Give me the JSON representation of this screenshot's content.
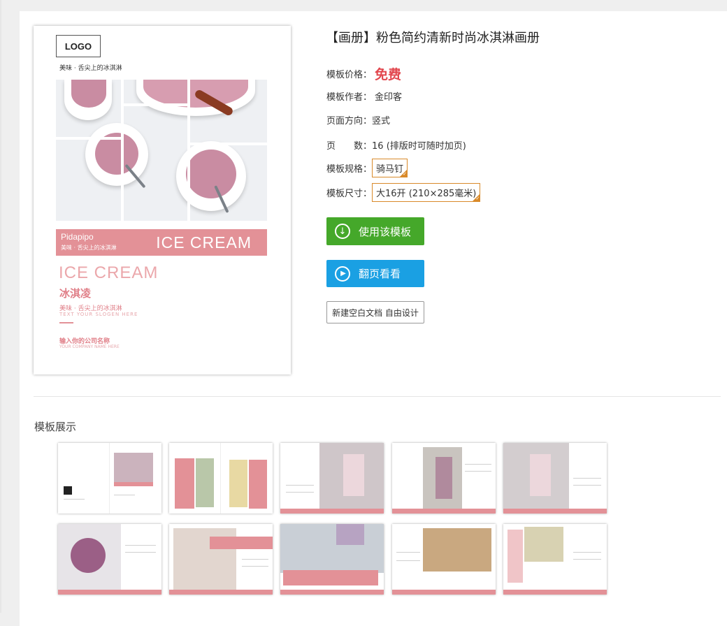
{
  "product": {
    "title": "【画册】粉色简约清新时尚冰淇淋画册",
    "price_label": "模板价格：",
    "price_value": "免费",
    "author_label": "模板作者：",
    "author_value": "金印客",
    "orientation_label": "页面方向：",
    "orientation_value": "竖式",
    "pages_label": "页　　数：",
    "pages_value": "16 (排版时可随时加页)",
    "spec_label": "模板规格：",
    "spec_value": "骑马钉",
    "size_label": "模板尺寸：",
    "size_value": "大16开 (210×285毫米)"
  },
  "buttons": {
    "use_template": "使用该模板",
    "flip_preview": "翻页看看",
    "new_blank": "新建空白文档 自由设计"
  },
  "cover": {
    "logo": "LOGO",
    "tagline": "美味 · 舌尖上的冰淇淋",
    "brand": "Pidapipo",
    "band_sub": "美味 · 舌尖上的冰淇淋",
    "band_title": "ICE CREAM",
    "big_title": "ICE CREAM",
    "cn_title": "冰淇凌",
    "slogan_cn": "美味 · 舌尖上的冰淇淋",
    "slogan_en": "TEXT YOUR SLOGEN HERE",
    "company_cn": "输入你的公司名称",
    "company_en": "YOUR COMPANY NAME HERE"
  },
  "showcase": {
    "title": "模板展示"
  },
  "colors": {
    "accent_pink": "#e39197",
    "free_red": "#e2474e",
    "green_button": "#45a82a",
    "blue_button": "#1aa0e3",
    "tag_orange": "#d98a2a"
  }
}
